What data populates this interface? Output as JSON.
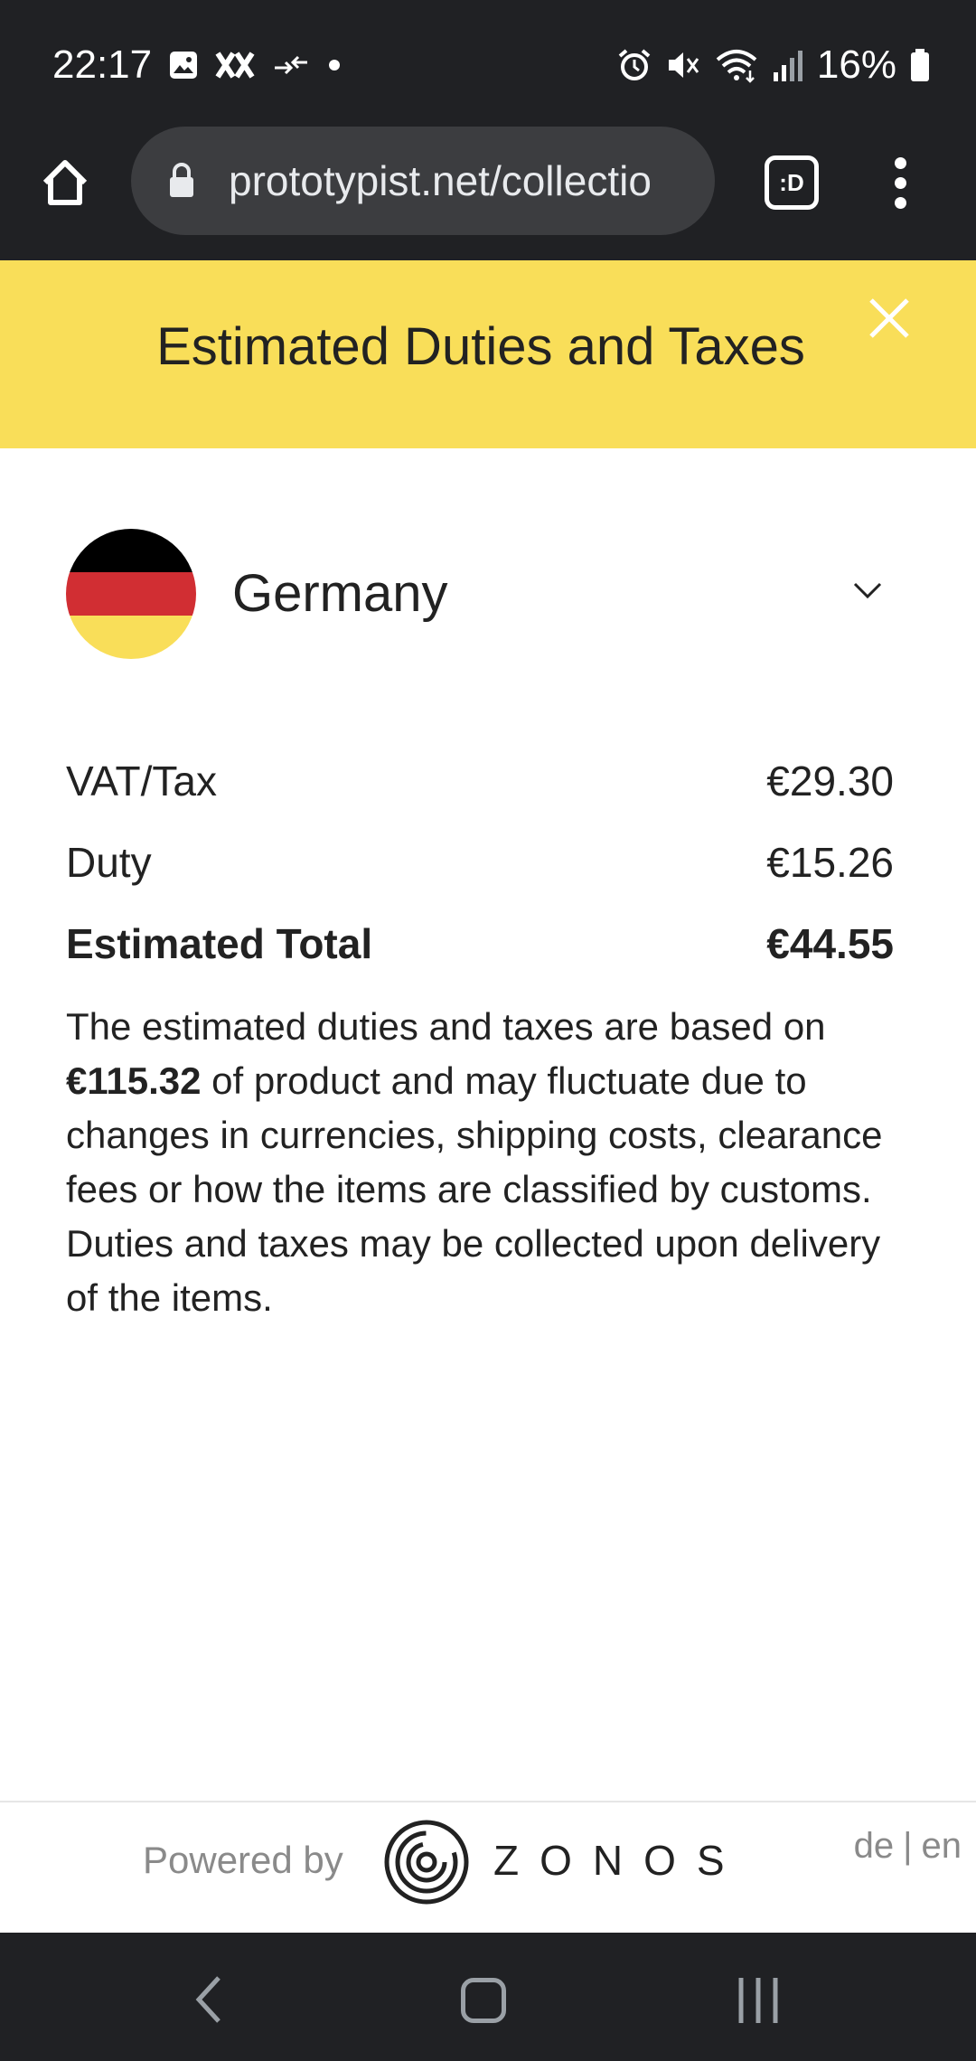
{
  "status_bar": {
    "time": "22:17",
    "battery": "16%",
    "left_icons": [
      "image-icon",
      "xx-icon",
      "data-transfer-icon",
      "dot-icon"
    ],
    "right_icons": [
      "alarm-icon",
      "mute-icon",
      "wifi-icon",
      "signal-icon",
      "battery-icon"
    ]
  },
  "browser": {
    "url": "prototypist.net/collectio",
    "tab_label": ":D"
  },
  "modal": {
    "title": "Estimated Duties and Taxes"
  },
  "country": {
    "name": "Germany",
    "flag_colors": [
      "#000000",
      "#d12e33",
      "#f9de59"
    ]
  },
  "lines": {
    "vat_label": "VAT/Tax",
    "vat_value": "€29.30",
    "duty_label": "Duty",
    "duty_value": "€15.26",
    "total_label": "Estimated Total",
    "total_value": "€44.55"
  },
  "note": {
    "before": "The estimated duties and taxes are based on ",
    "amount": "€115.32",
    "after": " of product and may fluctuate due to changes in currencies, shipping costs, clearance fees or how the items are classified by customs. Duties and taxes may be collected upon delivery of the items."
  },
  "footer": {
    "powered_by": "Powered by",
    "brand": "ZONOS",
    "lang_de": "de",
    "lang_sep": "|",
    "lang_en": "en"
  },
  "colors": {
    "header_yellow": "#f9de59",
    "dark_chrome": "#202124"
  }
}
